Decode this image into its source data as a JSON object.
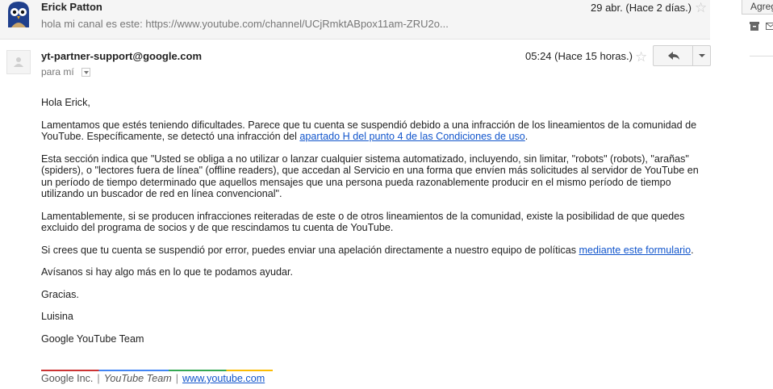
{
  "collapsed_message": {
    "sender": "Erick Patton",
    "snippet": "hola mi canal es este: https://www.youtube.com/channel/UCjRmktABpox11am-ZRU2o...",
    "date": "29 abr. (Hace 2 días.)"
  },
  "expanded_message": {
    "sender": "yt-partner-support@google.com",
    "to": "para mí",
    "date": "05:24 (Hace 15 horas.)",
    "body": {
      "greeting": "Hola Erick,",
      "p1_text": "Lamentamos que estés teniendo dificultades. Parece que tu cuenta se suspendió debido a una infracción de los lineamientos de la comunidad de YouTube. Específicamente, se detectó una infracción del ",
      "p1_link": "apartado H del punto 4 de las Condiciones de uso",
      "p1_end": ".",
      "p2": "Esta sección indica que \"Usted se obliga a no utilizar o lanzar cualquier sistema automatizado, incluyendo, sin limitar, \"robots\" (robots), \"arañas\" (spiders), o \"lectores fuera de línea\" (offline readers), que accedan al Servicio en una forma que envíen más solicitudes al servidor de YouTube en un período de tiempo determinado que aquellos mensajes que una persona pueda razonablemente producir en el mismo período de tiempo utilizando un buscador de red en línea convencional\".",
      "p3": "Lamentablemente, si se producen infracciones reiteradas de este o de otros lineamientos de la comunidad, existe la posibilidad de que quedes excluido del programa de socios y de que rescindamos tu cuenta de YouTube.",
      "p4_text": "Si crees que tu cuenta se suspendió por error, puedes enviar una apelación directamente a nuestro equipo de políticas ",
      "p4_link": "mediante este formulario",
      "p4_end": ".",
      "p5": "Avísanos si hay algo más en lo que te podamos ayudar.",
      "p6": "Gracias.",
      "p7": "Luisina",
      "p8": "Google YouTube Team"
    },
    "footer": {
      "company": "Google Inc.",
      "team": "YouTube Team",
      "link": "www.youtube.com"
    }
  },
  "sidebar": {
    "add_button": "Agregar"
  },
  "icons": {
    "star": "star-icon",
    "reply": "reply-icon",
    "more": "chevron-down-icon"
  },
  "colors": {
    "link": "#1155cc",
    "footer_red": "#cc3333",
    "footer_blue": "#4285f4",
    "footer_green": "#34a853",
    "footer_yellow": "#fbbc05"
  }
}
